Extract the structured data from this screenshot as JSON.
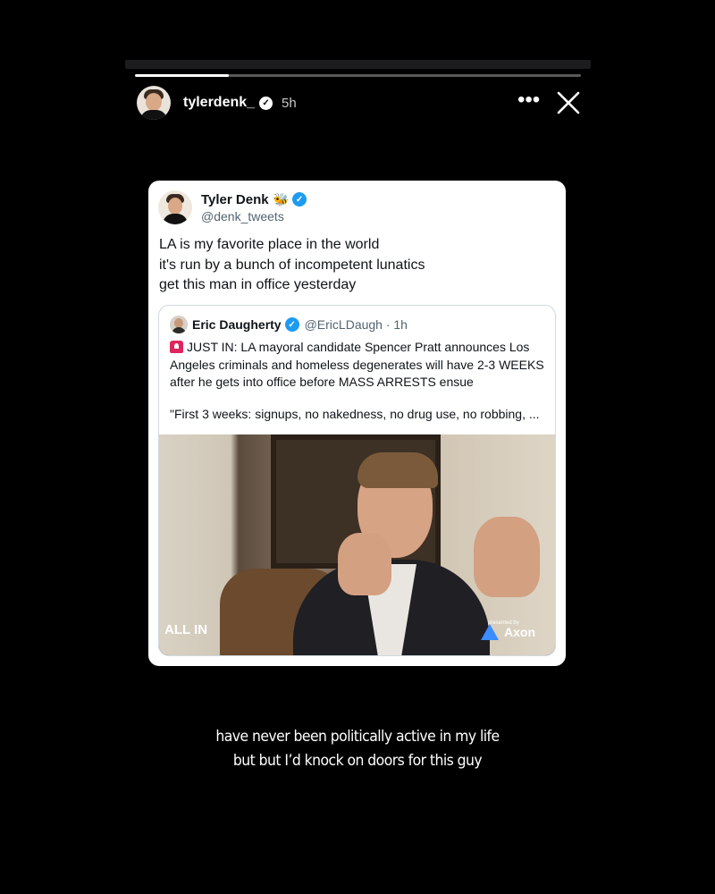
{
  "story": {
    "progress": 0.21,
    "user": {
      "username": "tylerdenk_",
      "time": "5h",
      "verified": true
    },
    "more_icon": "more-horizontal-icon",
    "close_icon": "close-icon"
  },
  "tweet": {
    "author": {
      "name": "Tyler Denk",
      "handle": "@denk_tweets",
      "emoji": "🐝"
    },
    "lines": [
      "LA is my favorite place in the world",
      "it's run by a bunch of incompetent lunatics",
      "get this man in office yesterday"
    ],
    "quote": {
      "author": {
        "name": "Eric Daugherty",
        "handle_time": "@EricLDaugh · 1h"
      },
      "text": "JUST IN: LA mayoral candidate Spencer Pratt announces Los Angeles criminals and homeless degenerates will have 2-3 WEEKS after he gets into office before MASS ARRESTS ensue",
      "text2": "\"First 3 weeks: signups, no nakedness, no drug use, no robbing, ...",
      "video": {
        "logo_left": "ALL IN",
        "presented_by": "presented by",
        "logo_right": "Axon"
      }
    }
  },
  "caption": {
    "line1": "have never been politically active in my life",
    "line2": "but but I’d knock on doors for this guy"
  },
  "colors": {
    "verified_blue": "#1d9bf0",
    "background": "#000000",
    "card": "#ffffff"
  }
}
